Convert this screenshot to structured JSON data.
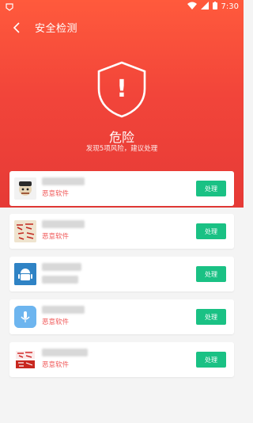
{
  "status": {
    "time": "7:30"
  },
  "topbar": {
    "title": "安全检测"
  },
  "hero": {
    "shield_symbol": "!",
    "status_title": "危险",
    "status_subtitle": "发现5项风险，建议处理"
  },
  "risks": [
    {
      "name": "",
      "label": "恶意软件",
      "action": "处理",
      "icon": "mascot-icon"
    },
    {
      "name": "",
      "label": "恶意软件",
      "action": "处理",
      "icon": "calligraphy-icon"
    },
    {
      "name": "",
      "label": "恶意软件",
      "action": "处理",
      "icon": "android-icon"
    },
    {
      "name": "",
      "label": "恶意软件",
      "action": "处理",
      "icon": "microphone-icon"
    },
    {
      "name": "",
      "label": "恶意软件",
      "action": "处理",
      "icon": "chinese-text-icon"
    }
  ],
  "colors": {
    "accent_red": "#e63a36",
    "action_green": "#1ac184",
    "label_red": "#f05a5a"
  }
}
